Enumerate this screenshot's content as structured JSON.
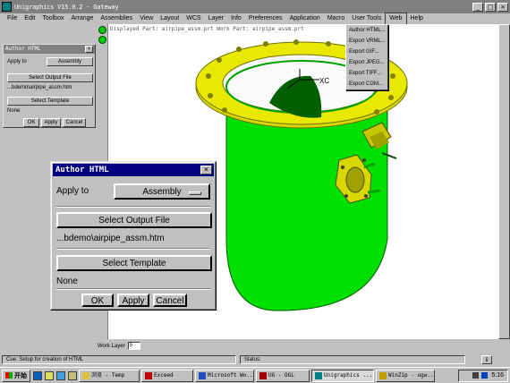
{
  "window": {
    "title": "Unigraphics V15.0.2 - Gateway",
    "controls": [
      "_",
      "□",
      "×"
    ]
  },
  "menubar": {
    "items": [
      "File",
      "Edit",
      "Toolbox",
      "Arrange",
      "Assemblies",
      "View",
      "Layout",
      "WCS",
      "Layer",
      "Info",
      "Preferences",
      "Application",
      "Macro",
      "User Tools",
      "Web",
      "Help"
    ],
    "active": "Web"
  },
  "web_menu": {
    "items": [
      "Author HTML...",
      "Export VRML...",
      "Export GIF...",
      "Export JPEG...",
      "Export TIFF...",
      "Export CGM..."
    ]
  },
  "viewport": {
    "info": "Displayed Part: airpipe_assm.prt    Work Part: airpipe_assm.prt",
    "axis_label": "XC",
    "colors": {
      "body": "#00e000",
      "flange": "#d8d800",
      "background": "#ffffff"
    }
  },
  "small_dialog": {
    "title": "Author HTML",
    "apply_to_label": "Apply to",
    "apply_to_value": "Assembly",
    "select_output_label": "Select Output File",
    "output_path": "...bdemo\\airpipe_assm.htm",
    "select_template_label": "Select Template",
    "template_value": "None",
    "ok": "OK",
    "apply": "Apply",
    "cancel": "Cancel"
  },
  "big_dialog": {
    "title": "Author HTML",
    "apply_to_label": "Apply to",
    "apply_to_value": "Assembly",
    "select_output_label": "Select Output File",
    "output_path": "...bdemo\\airpipe_assm.htm",
    "select_template_label": "Select Template",
    "template_value": "None",
    "ok": "OK",
    "apply": "Apply",
    "cancel": "Cancel"
  },
  "work_layer": {
    "label": "Work Layer",
    "value": "5"
  },
  "status_bar": {
    "cue": "Cue: Setup for creation of HTML",
    "status": "Status:",
    "info_icon": "i"
  },
  "taskbar": {
    "start": "开始",
    "tasks": [
      {
        "label": "浏览 - Temp",
        "icon": "folder-icon"
      },
      {
        "label": "Exceed",
        "icon": "exceed-icon"
      },
      {
        "label": "Microsoft Wo...",
        "icon": "word-icon"
      },
      {
        "label": "UG - OGL",
        "icon": "ug-icon"
      },
      {
        "label": "Unigraphics ...",
        "icon": "unigraphics-icon"
      },
      {
        "label": "WinZip - ugw...",
        "icon": "winzip-icon"
      }
    ],
    "clock": "5:16"
  }
}
